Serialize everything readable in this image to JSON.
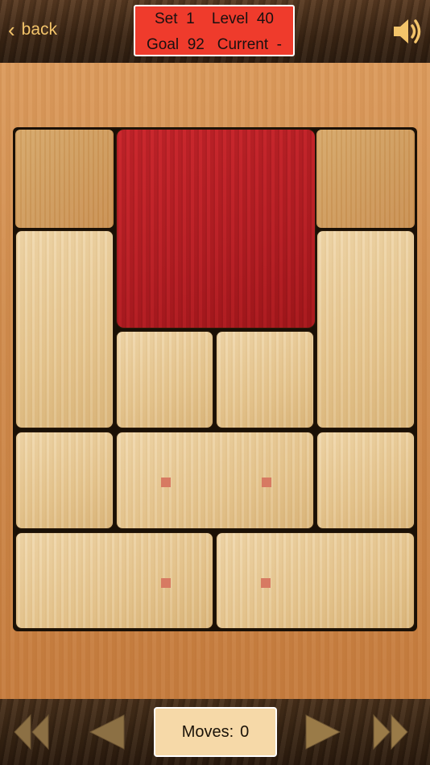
{
  "header": {
    "back_label": "back",
    "set_label": "Set",
    "set_value": "1",
    "level_label": "Level",
    "level_value": "40",
    "goal_label": "Goal",
    "goal_value": "92",
    "current_label": "Current",
    "current_value": "-"
  },
  "footer": {
    "moves_label": "Moves:",
    "moves_value": "0"
  },
  "icons": {
    "back": "chevron-left-icon",
    "sound": "speaker-icon",
    "first": "double-arrow-left-icon",
    "prev": "arrow-left-icon",
    "next": "arrow-right-icon",
    "last": "double-arrow-right-icon"
  },
  "colors": {
    "header_box": "#ef3b2c",
    "target_block": "#b51e24",
    "accent_text": "#f3c46a",
    "marker": "#d77a62"
  }
}
